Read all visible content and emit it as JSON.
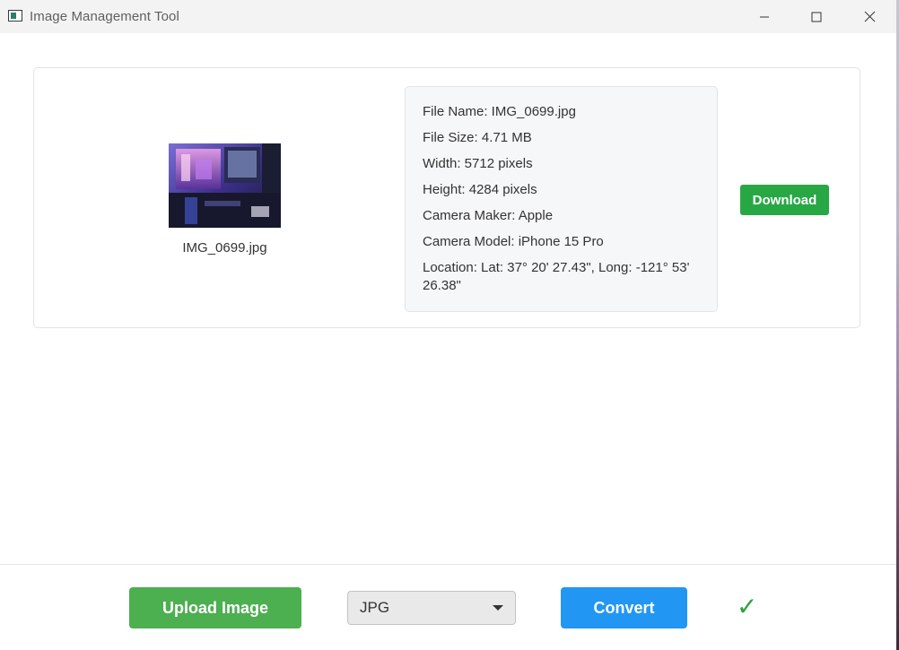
{
  "window": {
    "title": "Image Management Tool"
  },
  "image_card": {
    "thumbnail_caption": "IMG_0699.jpg",
    "metadata": [
      "File Name: IMG_0699.jpg",
      "File Size: 4.71 MB",
      "Width: 5712 pixels",
      "Height: 4284 pixels",
      "Camera Maker: Apple",
      "Camera Model: iPhone 15 Pro",
      "Location: Lat: 37° 20' 27.43\", Long: -121° 53' 26.38\""
    ],
    "download_label": "Download"
  },
  "toolbar": {
    "upload_label": "Upload Image",
    "format_selected": "JPG",
    "convert_label": "Convert",
    "status_icon": "check-icon"
  },
  "colors": {
    "download": "#28a745",
    "upload": "#4caf50",
    "convert": "#2196f3",
    "status_check": "#2aa33a"
  }
}
